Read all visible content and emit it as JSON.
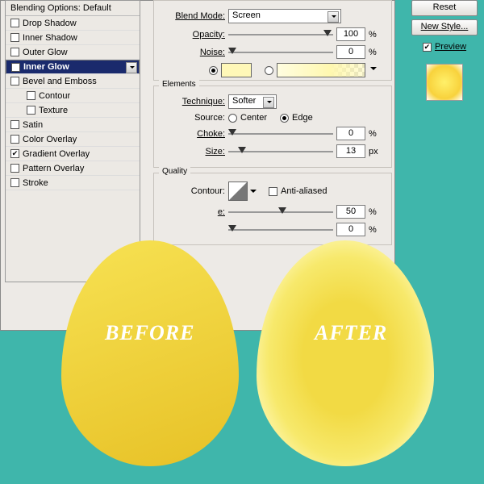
{
  "sidebar": {
    "header": "Blending Options: Default",
    "items": [
      {
        "label": "Drop Shadow",
        "checked": false,
        "sub": false
      },
      {
        "label": "Inner Shadow",
        "checked": false,
        "sub": false
      },
      {
        "label": "Outer Glow",
        "checked": false,
        "sub": false
      },
      {
        "label": "Inner Glow",
        "checked": true,
        "sub": false,
        "selected": true
      },
      {
        "label": "Bevel and Emboss",
        "checked": false,
        "sub": false
      },
      {
        "label": "Contour",
        "checked": false,
        "sub": true
      },
      {
        "label": "Texture",
        "checked": false,
        "sub": true
      },
      {
        "label": "Satin",
        "checked": false,
        "sub": false
      },
      {
        "label": "Color Overlay",
        "checked": false,
        "sub": false
      },
      {
        "label": "Gradient Overlay",
        "checked": true,
        "sub": false
      },
      {
        "label": "Pattern Overlay",
        "checked": false,
        "sub": false
      },
      {
        "label": "Stroke",
        "checked": false,
        "sub": false
      }
    ]
  },
  "structure": {
    "blend_mode_label": "Blend Mode:",
    "blend_mode_value": "Screen",
    "opacity_label": "Opacity:",
    "opacity_value": "100",
    "opacity_unit": "%",
    "noise_label": "Noise:",
    "noise_value": "0",
    "noise_unit": "%",
    "color_swatch": "#fff8b8",
    "grad_swatch": "linear-gradient(90deg,#fffde0,#fff8b0)"
  },
  "elements": {
    "legend": "Elements",
    "technique_label": "Technique:",
    "technique_value": "Softer",
    "source_label": "Source:",
    "src_center": "Center",
    "src_edge": "Edge",
    "choke_label": "Choke:",
    "choke_value": "0",
    "choke_unit": "%",
    "size_label": "Size:",
    "size_value": "13",
    "size_unit": "px"
  },
  "quality": {
    "legend": "Quality",
    "contour_label": "Contour:",
    "aa_label": "Anti-aliased",
    "range_label": "e:",
    "range_value": "50",
    "jitter_value": "0",
    "pct": "%"
  },
  "right": {
    "reset": "Reset",
    "new_style": "New Style...",
    "preview": "Preview"
  },
  "eggs": {
    "before": "BEFORE",
    "after": "AFTER"
  }
}
